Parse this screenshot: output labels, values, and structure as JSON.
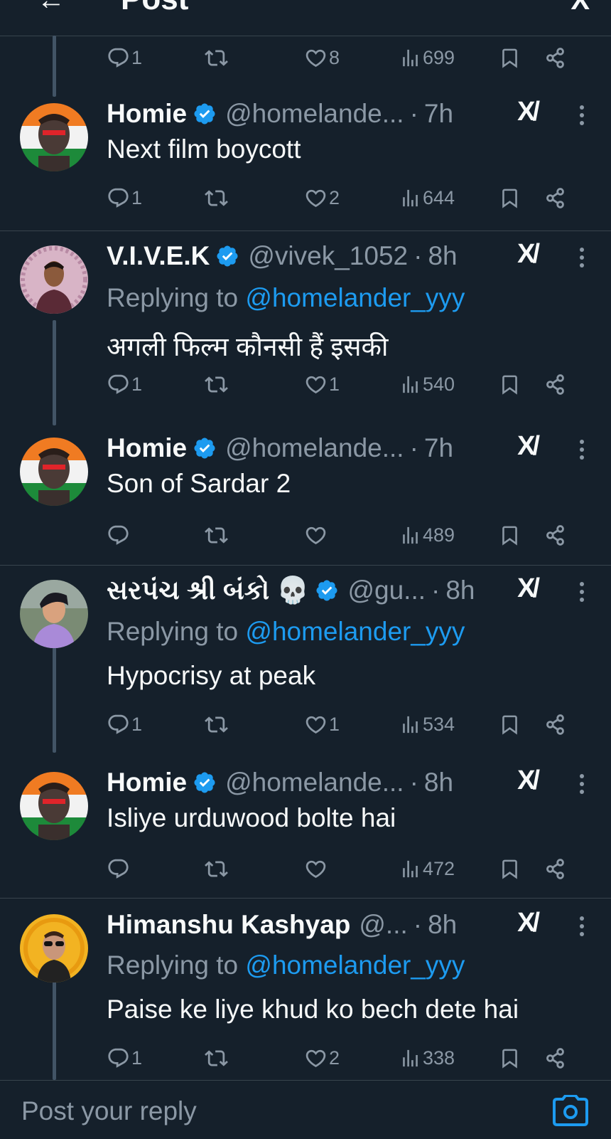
{
  "header": {
    "back_glyph": "←",
    "title": "Post",
    "logo_text": "X"
  },
  "icons": {
    "reply": "reply-icon",
    "repost": "repost-icon",
    "like": "heart-icon",
    "views": "views-icon",
    "bookmark": "bookmark-icon",
    "share": "share-icon",
    "grok": "grok-icon",
    "more": "more-icon",
    "verified": "verified-badge-icon"
  },
  "colors": {
    "background": "#15202b",
    "accent": "#1d9bf0",
    "muted": "#8b98a5",
    "text": "#f7f9f9",
    "divider": "#38444d"
  },
  "top_actions": {
    "replies": "1",
    "reposts": "",
    "likes": "8",
    "views": "699"
  },
  "tweets": [
    {
      "name": "Homie",
      "handle": "@homelande...",
      "dot": "·",
      "time": "7h",
      "grok_label": "X/",
      "text": "Next film boycott",
      "replies": "1",
      "reposts": "",
      "likes": "2",
      "views": "644"
    },
    {
      "name": "V.I.V.E.K",
      "handle": "@vivek_1052",
      "dot": "·",
      "time": "8h",
      "grok_label": "X/",
      "replying_prefix": "Replying to",
      "replying_to": "@homelander_yyy",
      "text": "अगली फिल्म कौनसी हैं इसकी",
      "replies": "1",
      "reposts": "",
      "likes": "1",
      "views": "540"
    },
    {
      "name": "Homie",
      "handle": "@homelande...",
      "dot": "·",
      "time": "7h",
      "grok_label": "X/",
      "text": "Son of Sardar 2",
      "replies": "",
      "reposts": "",
      "likes": "",
      "views": "489"
    },
    {
      "name": "સરપંચ શ્રી બંકો 💀",
      "handle": "@gu...",
      "dot": "·",
      "time": "8h",
      "grok_label": "X/",
      "replying_prefix": "Replying to",
      "replying_to": "@homelander_yyy",
      "text": "Hypocrisy at peak",
      "replies": "1",
      "reposts": "",
      "likes": "1",
      "views": "534"
    },
    {
      "name": "Homie",
      "handle": "@homelande...",
      "dot": "·",
      "time": "8h",
      "grok_label": "X/",
      "text": "Isliye urduwood bolte hai",
      "replies": "",
      "reposts": "",
      "likes": "",
      "views": "472"
    },
    {
      "name": "Himanshu Kashyap",
      "handle": "@...",
      "dot": "·",
      "time": "8h",
      "grok_label": "X/",
      "replying_prefix": "Replying to",
      "replying_to": "@homelander_yyy",
      "text": "Paise ke liye khud ko bech dete hai",
      "replies": "1",
      "reposts": "",
      "likes": "2",
      "views": "338"
    }
  ],
  "composer": {
    "placeholder": "Post your reply",
    "camera_icon": "camera-icon"
  }
}
